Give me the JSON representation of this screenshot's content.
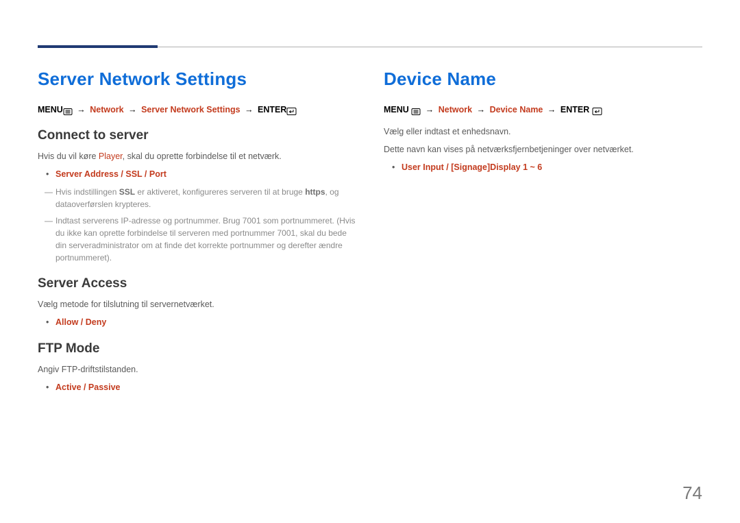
{
  "page_number": "74",
  "left": {
    "title": "Server Network Settings",
    "crumb": {
      "menu": "MENU",
      "arrow1": "→",
      "p1": "Network",
      "arrow2": "→",
      "p2": "Server Network Settings",
      "arrow3": "→",
      "enter": "ENTER"
    },
    "s1": {
      "heading": "Connect to server",
      "body_pre": "Hvis du vil køre ",
      "body_red": "Player",
      "body_post": ", skal du oprette forbindelse til et netværk.",
      "bullet1": "Server Address / SSL / Port",
      "note1_pre": "Hvis indstillingen ",
      "note1_b1": "SSL",
      "note1_mid": " er aktiveret, konfigureres serveren til at bruge ",
      "note1_b2": "https",
      "note1_post": ", og dataoverførslen krypteres.",
      "note2": "Indtast serverens IP-adresse og portnummer. Brug 7001 som portnummeret. (Hvis du ikke kan oprette forbindelse til serveren med portnummer 7001, skal du bede din serveradministrator om at finde det korrekte portnummer og derefter ændre portnummeret)."
    },
    "s2": {
      "heading": "Server Access",
      "body": "Vælg metode for tilslutning til servernetværket.",
      "bullet1": "Allow / Deny"
    },
    "s3": {
      "heading": "FTP Mode",
      "body": "Angiv FTP-driftstilstanden.",
      "bullet1": "Active / Passive"
    }
  },
  "right": {
    "title": "Device Name",
    "crumb": {
      "menu": "MENU",
      "arrow1": "→",
      "p1": "Network",
      "arrow2": "→",
      "p2": "Device Name",
      "arrow3": "→",
      "enter": "ENTER"
    },
    "body1": "Vælg eller indtast et enhedsnavn.",
    "body2": "Dette navn kan vises på netværksfjernbetjeninger over netværket.",
    "bullet1": "User Input / [Signage]Display 1 ~ 6"
  }
}
